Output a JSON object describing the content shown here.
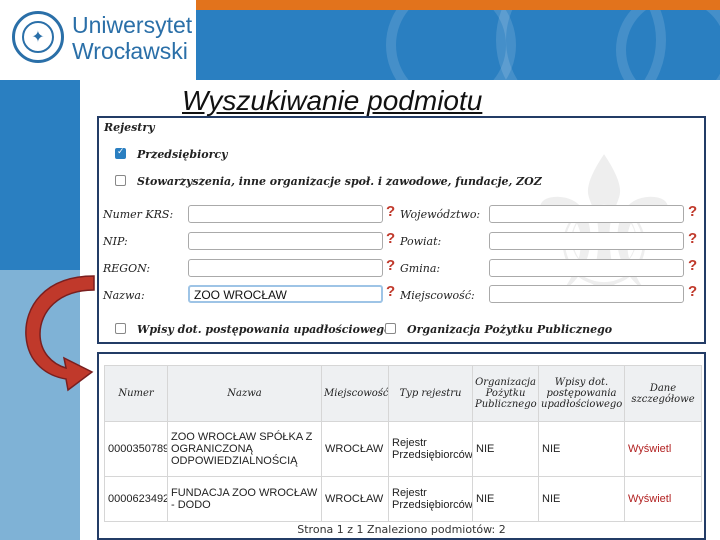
{
  "logo": {
    "line1": "Uniwersytet",
    "line2": "Wrocławski"
  },
  "slide": {
    "title": "Wyszukiwanie podmiotu"
  },
  "search": {
    "section_title": "Rejestry",
    "checkboxes": [
      {
        "label": "Przedsiębiorcy",
        "checked": true
      },
      {
        "label": "Stowarzyszenia, inne organizacje społ. i zawodowe, fundacje, ZOZ",
        "checked": false
      }
    ],
    "fields_left": [
      {
        "label": "Numer KRS:",
        "value": ""
      },
      {
        "label": "NIP:",
        "value": ""
      },
      {
        "label": "REGON:",
        "value": ""
      },
      {
        "label": "Nazwa:",
        "value": "ZOO WROCŁAW"
      }
    ],
    "fields_right": [
      {
        "label": "Województwo:",
        "value": ""
      },
      {
        "label": "Powiat:",
        "value": ""
      },
      {
        "label": "Gmina:",
        "value": ""
      },
      {
        "label": "Miejscowość:",
        "value": ""
      }
    ],
    "help_icon": "?",
    "bottom_options": [
      {
        "label": "Wpisy dot. postępowania upadłościowego",
        "checked": false
      },
      {
        "label": "Organizacja Pożytku Publicznego",
        "checked": false
      }
    ]
  },
  "results": {
    "headers": [
      "Numer",
      "Nazwa",
      "Miejscowość",
      "Typ rejestru",
      "Organizacja Pożytku Publicznego",
      "Wpisy dot. postępowania upadłościowego",
      "Dane szczegółowe"
    ],
    "rows": [
      [
        "0000350789",
        "ZOO WROCŁAW SPÓŁKA Z OGRANICZONĄ ODPOWIEDZIALNOŚCIĄ",
        "WROCŁAW",
        "Rejestr Przedsiębiorców",
        "NIE",
        "NIE",
        "Wyświetl"
      ],
      [
        "0000623492",
        "FUNDACJA ZOO WROCŁAW - DODO",
        "WROCŁAW",
        "Rejestr Przedsiębiorców",
        "NIE",
        "NIE",
        "Wyświetl"
      ]
    ],
    "pager": "Strona 1 z 1 Znaleziono podmiotów: 2"
  },
  "colors": {
    "brand_blue": "#2a7fc1",
    "accent_orange": "#e2731c",
    "frame_navy": "#233c66",
    "link_red": "#b22222",
    "arrow_red": "#c0392b"
  },
  "icons": {
    "logo": "university-emblem-icon",
    "help": "question-mark-icon",
    "arrow": "curved-arrow-icon"
  }
}
